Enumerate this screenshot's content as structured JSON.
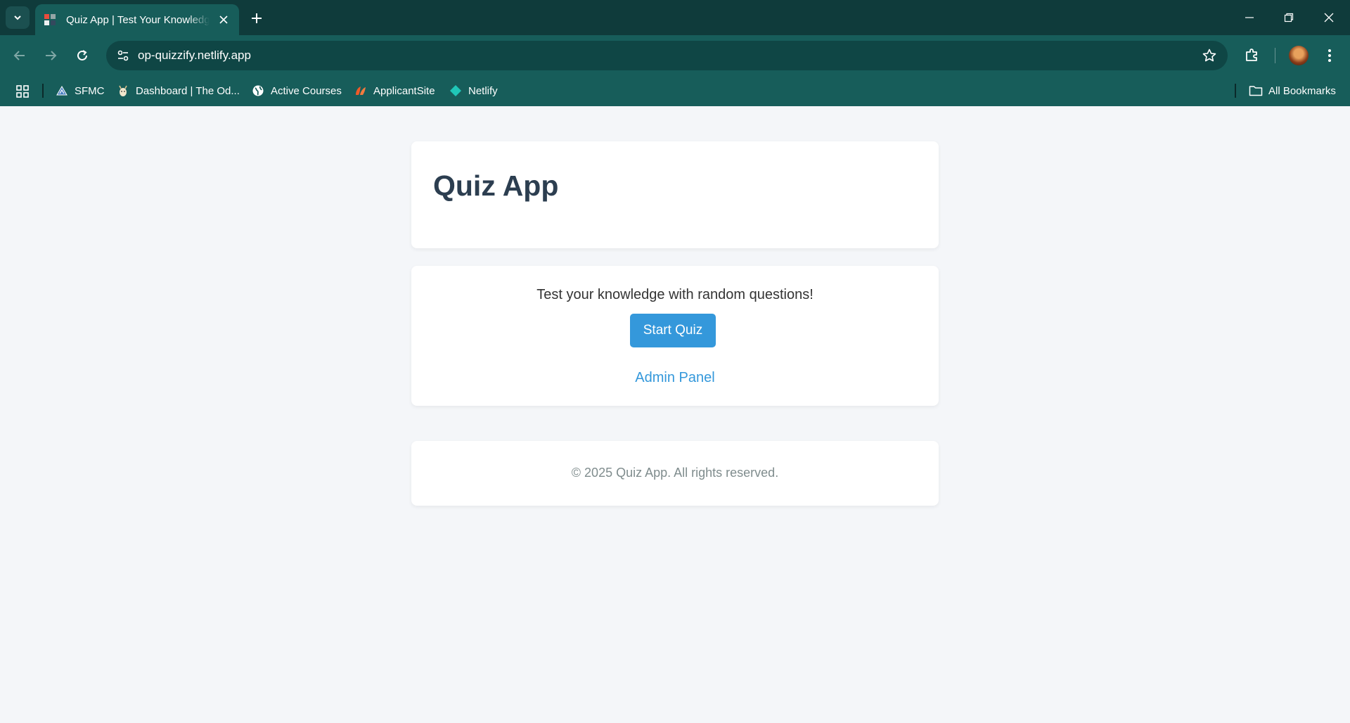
{
  "browser": {
    "tab": {
      "title": "Quiz App | Test Your Knowledge"
    },
    "url": "op-quizzify.netlify.app",
    "bookmarks": [
      {
        "label": "SFMC",
        "icon": "sfmc-icon"
      },
      {
        "label": "Dashboard | The Od...",
        "icon": "odin-icon"
      },
      {
        "label": "Active Courses",
        "icon": "globe-icon"
      },
      {
        "label": "ApplicantSite",
        "icon": "applicantsite-icon"
      },
      {
        "label": "Netlify",
        "icon": "netlify-icon"
      }
    ],
    "all_bookmarks_label": "All Bookmarks"
  },
  "app": {
    "title": "Quiz App",
    "tagline": "Test your knowledge with random questions!",
    "start_button": "Start Quiz",
    "admin_link": "Admin Panel",
    "footer": "© 2025 Quiz App. All rights reserved."
  },
  "colors": {
    "chrome_dark": "#0f3b3b",
    "chrome": "#175d5a",
    "page_bg": "#f4f6f9",
    "title": "#2c3e50",
    "accent": "#3498db",
    "footer_text": "#7f8c8d"
  }
}
